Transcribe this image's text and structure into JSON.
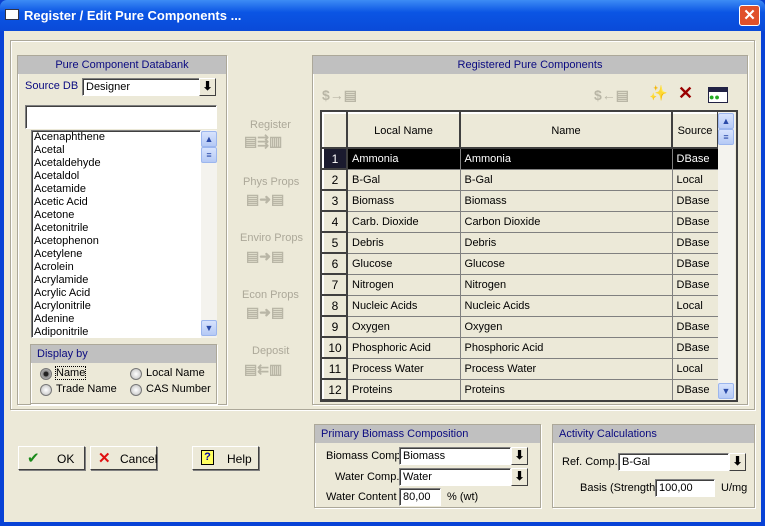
{
  "window": {
    "title": "Register / Edit Pure Components ...",
    "close": "✕"
  },
  "databank": {
    "header": "Pure Component Databank",
    "source_label": "Source DB",
    "source_value": "Designer",
    "search_value": "",
    "items": [
      "Acenaphthene",
      "Acetal",
      "Acetaldehyde",
      "Acetaldol",
      "Acetamide",
      "Acetic Acid",
      "Acetone",
      "Acetonitrile",
      "Acetophenon",
      "Acetylene",
      "Acrolein",
      "Acrylamide",
      "Acrylic Acid",
      "Acrylonitrile",
      "Adenine",
      "Adiponitrile"
    ],
    "display_by": {
      "label": "Display by",
      "options": [
        {
          "label": "Name",
          "selected": true
        },
        {
          "label": "Local Name",
          "selected": false
        },
        {
          "label": "Trade Name",
          "selected": false
        },
        {
          "label": "CAS Number",
          "selected": false
        }
      ]
    }
  },
  "actions": {
    "register": "Register",
    "phys_props": "Phys Props",
    "enviro_props": "Enviro Props",
    "econ_props": "Econ Props",
    "deposit": "Deposit"
  },
  "registered": {
    "header": "Registered Pure Components",
    "columns": [
      "Local Name",
      "Name",
      "Source"
    ],
    "rows": [
      [
        "1",
        "Ammonia",
        "Ammonia",
        "DBase"
      ],
      [
        "2",
        "B-Gal",
        "B-Gal",
        "Local"
      ],
      [
        "3",
        "Biomass",
        "Biomass",
        "DBase"
      ],
      [
        "4",
        "Carb. Dioxide",
        "Carbon Dioxide",
        "DBase"
      ],
      [
        "5",
        "Debris",
        "Debris",
        "DBase"
      ],
      [
        "6",
        "Glucose",
        "Glucose",
        "DBase"
      ],
      [
        "7",
        "Nitrogen",
        "Nitrogen",
        "DBase"
      ],
      [
        "8",
        "Nucleic Acids",
        "Nucleic Acids",
        "Local"
      ],
      [
        "9",
        "Oxygen",
        "Oxygen",
        "DBase"
      ],
      [
        "10",
        "Phosphoric Acid",
        "Phosphoric Acid",
        "DBase"
      ],
      [
        "11",
        "Process Water",
        "Process Water",
        "Local"
      ],
      [
        "12",
        "Proteins",
        "Proteins",
        "DBase"
      ]
    ],
    "selected_row": 1
  },
  "buttons": {
    "ok": "OK",
    "cancel": "Cancel",
    "help": "Help"
  },
  "biomass": {
    "header": "Primary Biomass Composition",
    "biomass_label": "Biomass Comp.",
    "biomass_value": "Biomass",
    "water_label": "Water Comp.",
    "water_value": "Water",
    "content_label": "Water Content",
    "content_value": "80,00",
    "content_unit": "% (wt)"
  },
  "activity": {
    "header": "Activity Calculations",
    "ref_label": "Ref. Comp.",
    "ref_value": "B-Gal",
    "basis_label": "Basis (Strength)",
    "basis_value": "100,00",
    "basis_unit": "U/mg"
  }
}
